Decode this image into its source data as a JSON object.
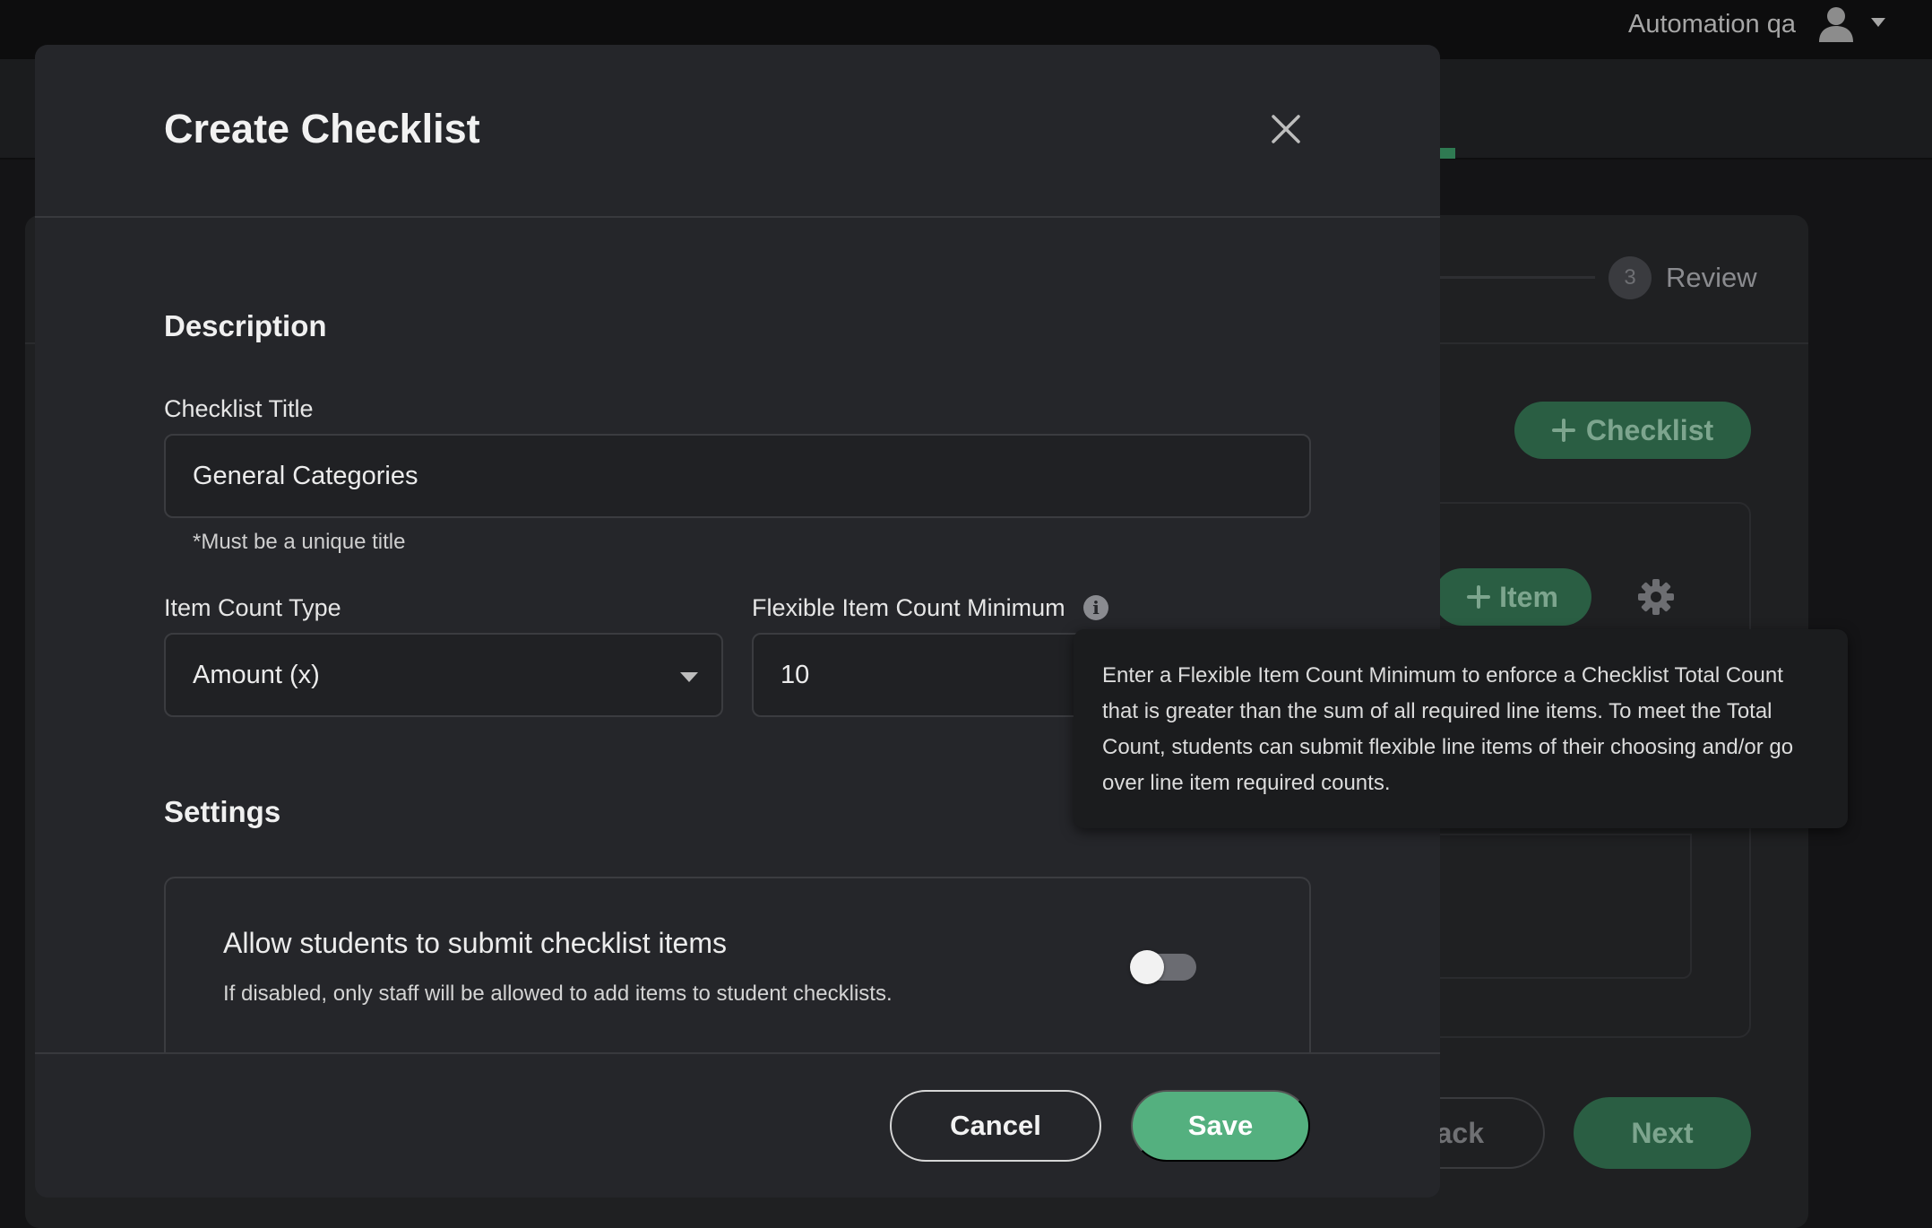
{
  "header": {
    "user_name": "Automation qa",
    "icons": {
      "avatar": "user-avatar-icon",
      "caret": "chevron-down-icon"
    }
  },
  "background": {
    "stepper": {
      "step_number": "3",
      "step_label": "Review"
    },
    "add_checklist_label": "Checklist",
    "add_item_label": "Item",
    "back_label": "ack",
    "next_label": "Next"
  },
  "modal": {
    "title": "Create Checklist",
    "description_section": {
      "heading": "Description",
      "checklist_title_label": "Checklist Title",
      "checklist_title_value": "General Categories",
      "checklist_title_hint": "*Must be a unique title",
      "item_count_type_label": "Item Count Type",
      "item_count_type_value": "Amount (x)",
      "flexible_min_label": "Flexible Item Count Minimum",
      "flexible_min_value": "10",
      "info_icon_glyph": "i"
    },
    "settings_section": {
      "heading": "Settings",
      "allow_students": {
        "title": "Allow students to submit checklist items",
        "description": "If disabled, only staff will be allowed to add items to student checklists.",
        "enabled": false
      }
    },
    "footer": {
      "cancel_label": "Cancel",
      "save_label": "Save"
    }
  },
  "tooltip": {
    "text": "Enter a Flexible Item Count Minimum to enforce a Checklist Total Count that is greater than the sum of all required line items. To meet the Total Count, students can submit flexible line items of their choosing and/or go over line item required counts."
  },
  "colors": {
    "accent_green": "#54b07f",
    "muted_green": "#2a5e43",
    "modal_bg": "#25262a",
    "page_bg": "#141416"
  }
}
